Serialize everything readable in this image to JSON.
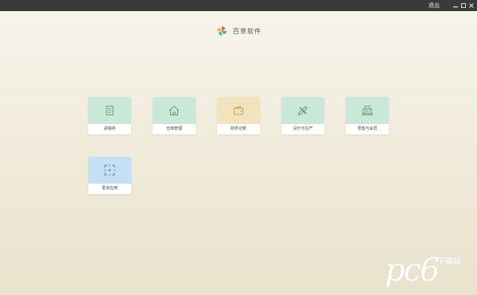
{
  "window": {
    "exit_label": "退出"
  },
  "header": {
    "app_title": "百草软件"
  },
  "tiles": [
    {
      "label": "进销存",
      "icon": "document-list-icon",
      "color": "#c9e8d7"
    },
    {
      "label": "仓库管理",
      "icon": "house-icon",
      "color": "#c9e8d7"
    },
    {
      "label": "财务记账",
      "icon": "wallet-icon",
      "color": "#f3e2be"
    },
    {
      "label": "设计与生产",
      "icon": "pencil-ruler-icon",
      "color": "#c9e8d7"
    },
    {
      "label": "零售与会员",
      "icon": "cash-register-icon",
      "color": "#c9e8d7"
    },
    {
      "label": "更多应用",
      "icon": "dashed-square-icon",
      "color": "#c5e0f5"
    }
  ],
  "watermark": {
    "main": "pc6",
    "sub": "下载站"
  }
}
